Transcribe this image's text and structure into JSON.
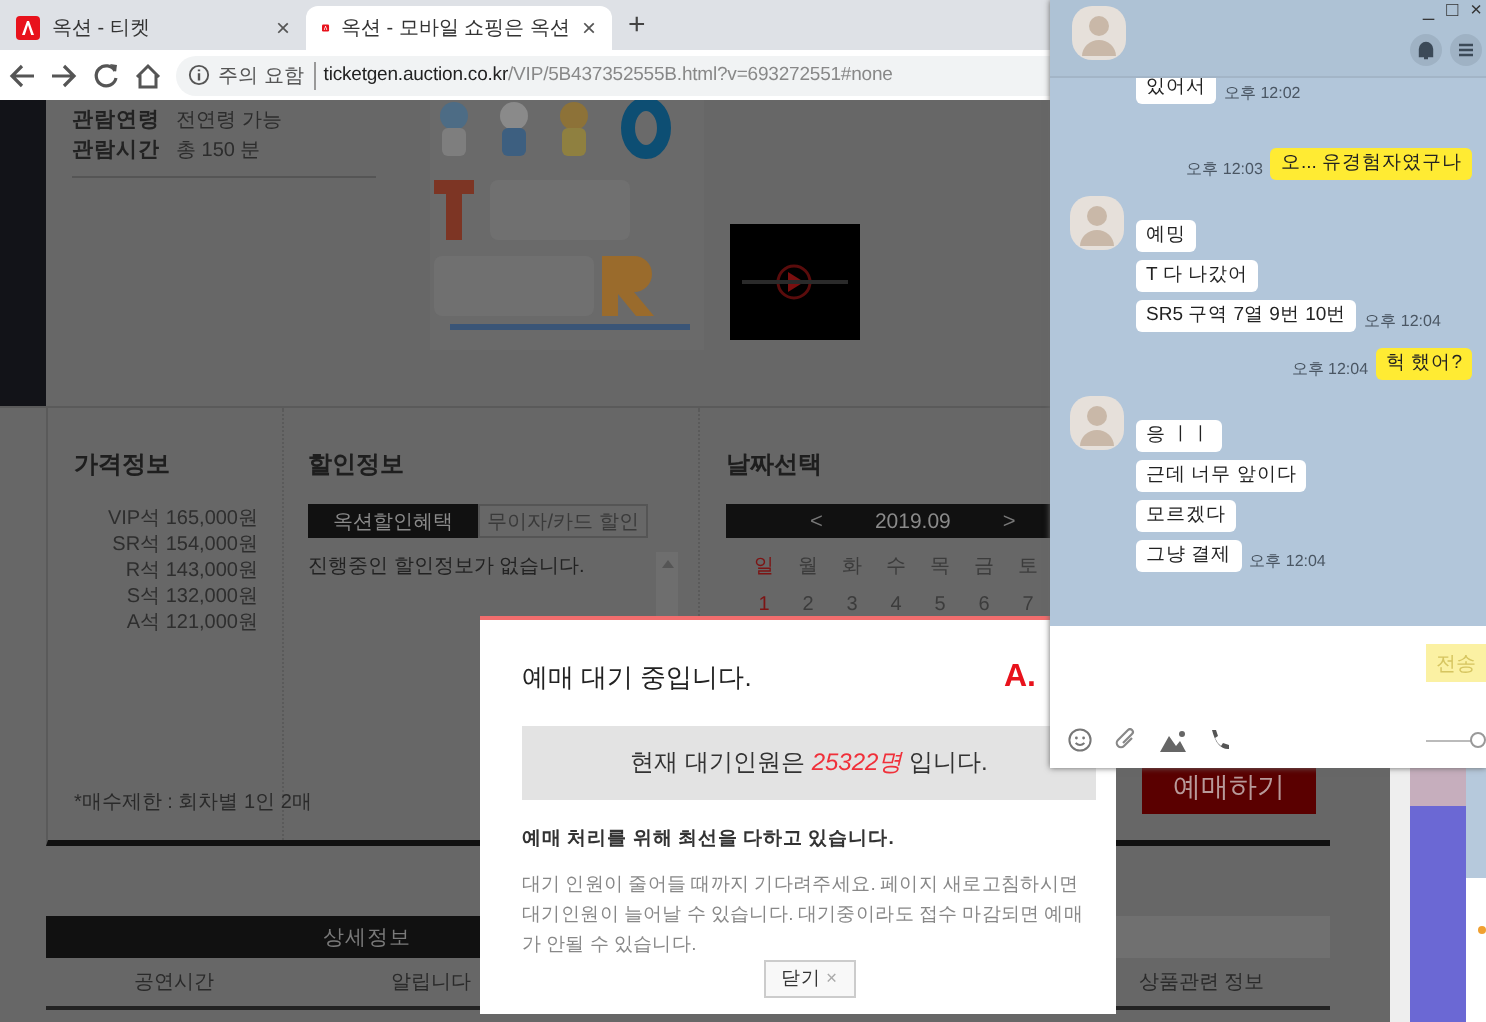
{
  "browser": {
    "tabs": [
      {
        "title": "옥션 - 티켓",
        "close": "×",
        "selected": false
      },
      {
        "title": "옥션 - 모바일 쇼핑은 옥션",
        "close": "×",
        "selected": true
      }
    ],
    "new_tab": "+",
    "address": {
      "security": "주의 요함",
      "host": "ticketgen.auction.co.kr",
      "path": "/VIP/5B437352555B.html?v=693272551#none"
    }
  },
  "page": {
    "info": [
      {
        "label": "관람연령",
        "value": "전연령 가능"
      },
      {
        "label": "관람시간",
        "value": "총 150 분"
      }
    ],
    "price": {
      "title": "가격정보",
      "rows": [
        "VIP석 165,000원",
        "SR석 154,000원",
        "R석 143,000원",
        "S석 132,000원",
        "A석 121,000원"
      ],
      "note": "*매수제한 : 회차별 1인 2매"
    },
    "discount": {
      "title": "할인정보",
      "tabs": [
        {
          "label": "옥션할인혜택",
          "selected": true
        },
        {
          "label": "무이자/카드 할인",
          "selected": false
        }
      ],
      "empty": "진행중인 할인정보가 없습니다."
    },
    "date": {
      "title": "날짜선택",
      "prev": "<",
      "month": "2019.09",
      "next": ">",
      "weekdays": [
        {
          "label": "일",
          "sunday": true
        },
        {
          "label": "월",
          "sunday": false
        },
        {
          "label": "화",
          "sunday": false
        },
        {
          "label": "수",
          "sunday": false
        },
        {
          "label": "목",
          "sunday": false
        },
        {
          "label": "금",
          "sunday": false
        },
        {
          "label": "토",
          "sunday": false
        }
      ],
      "dates": [
        {
          "label": "1",
          "sunday": true
        },
        {
          "label": "2",
          "sunday": false
        },
        {
          "label": "3",
          "sunday": false
        },
        {
          "label": "4",
          "sunday": false
        },
        {
          "label": "5",
          "sunday": false
        },
        {
          "label": "6",
          "sunday": false
        },
        {
          "label": "7",
          "sunday": false
        }
      ]
    },
    "book_button": "예매하기",
    "detail_tab": "상세정보",
    "sub_tabs_left": [
      "공연시간",
      "알립니다"
    ],
    "sub_tabs_right": [
      "상품관련 정보"
    ]
  },
  "modal": {
    "title": "예매 대기 중입니다.",
    "logo": "A.",
    "count_prefix": "현재 대기인원은",
    "count": "25322명",
    "count_suffix": "입니다.",
    "notice": "예매 처리를 위해 최선을 다하고 있습니다.",
    "body": "대기 인원이 줄어들 때까지 기다려주세요. 페이지 새로고침하시면 대기인원이 늘어날 수 있습니다. 대기중이라도 접수 마감되면 예매가 안될 수 있습니다.",
    "close_label": "닫기",
    "close_glyph": "×"
  },
  "chat": {
    "controls": [
      "_",
      "□",
      "×"
    ],
    "messages": [
      {
        "kind": "received",
        "avatar": false,
        "bubbles": [
          "있어서"
        ],
        "time": "오후 12:02"
      },
      {
        "kind": "sent",
        "bubbles": [
          "오... 유경험자였구나"
        ],
        "time": "오후 12:03"
      },
      {
        "kind": "received",
        "avatar": true,
        "bubbles": [
          "예밍",
          "T 다 나갔어",
          "SR5 구역 7열 9번 10번"
        ],
        "time": "오후 12:04"
      },
      {
        "kind": "sent",
        "bubbles": [
          "헉 했어?"
        ],
        "time": "오후 12:04"
      },
      {
        "kind": "received",
        "avatar": true,
        "bubbles": [
          "응 ㅣㅣ",
          "근데 너무 앞이다",
          "모르겠다",
          "그냥 결제"
        ],
        "time": "오후 12:04"
      }
    ],
    "send_button": "전송",
    "opacity_slider": {
      "level": 1
    }
  }
}
